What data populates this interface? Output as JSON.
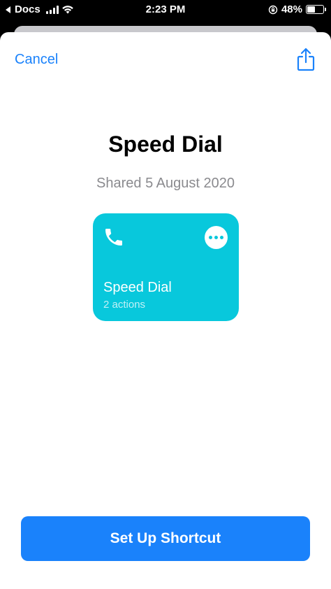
{
  "status_bar": {
    "back_app": "Docs",
    "time": "2:23 PM",
    "battery_percent": "48%",
    "battery_level": 0.48,
    "icons": [
      "back-caret-icon",
      "signal-icon",
      "wifi-icon",
      "orientation-lock-icon",
      "battery-icon"
    ]
  },
  "nav": {
    "cancel_label": "Cancel",
    "share_icon": "share-icon"
  },
  "shortcut": {
    "title": "Speed Dial",
    "shared_date": "Shared 5 August 2020",
    "card": {
      "name": "Speed Dial",
      "actions": "2 actions",
      "icon": "phone-icon",
      "more_icon": "ellipsis-icon",
      "color": "#08c8dc"
    }
  },
  "actions": {
    "setup_label": "Set Up Shortcut"
  },
  "colors": {
    "accent": "#1a82fb",
    "card": "#08c8dc",
    "subtitle": "#8a8a8e"
  }
}
